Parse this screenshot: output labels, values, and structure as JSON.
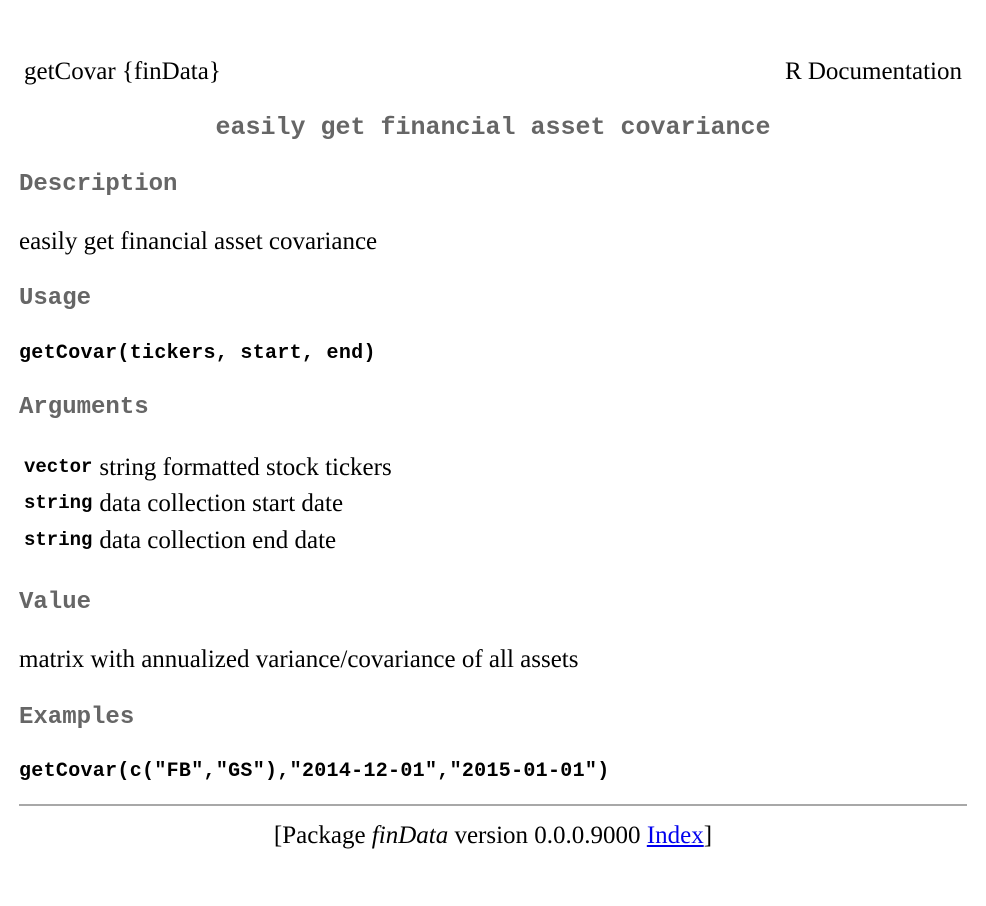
{
  "header": {
    "topic": "getCovar {finData}",
    "doc_label": "R Documentation"
  },
  "title": "easily get financial asset covariance",
  "sections": {
    "description": {
      "heading": "Description",
      "text": "easily get financial asset covariance"
    },
    "usage": {
      "heading": "Usage",
      "code": "getCovar(tickers, start, end)"
    },
    "arguments": {
      "heading": "Arguments",
      "items": [
        {
          "name": "vector",
          "desc": "string formatted stock tickers"
        },
        {
          "name": "string",
          "desc": "data collection start date"
        },
        {
          "name": "string",
          "desc": "data collection end date"
        }
      ]
    },
    "value": {
      "heading": "Value",
      "text": "matrix with annualized variance/covariance of all assets"
    },
    "examples": {
      "heading": "Examples",
      "code": "getCovar(c(\"FB\",\"GS\"),\"2014-12-01\",\"2015-01-01\")"
    }
  },
  "footer": {
    "prefix": "[Package ",
    "package_name": "finData",
    "version_text": " version 0.0.0.9000 ",
    "index_link": "Index",
    "suffix": "]"
  },
  "colors": {
    "heading": "#666666",
    "link": "#0000ee",
    "rule": "#a8a8a8"
  }
}
